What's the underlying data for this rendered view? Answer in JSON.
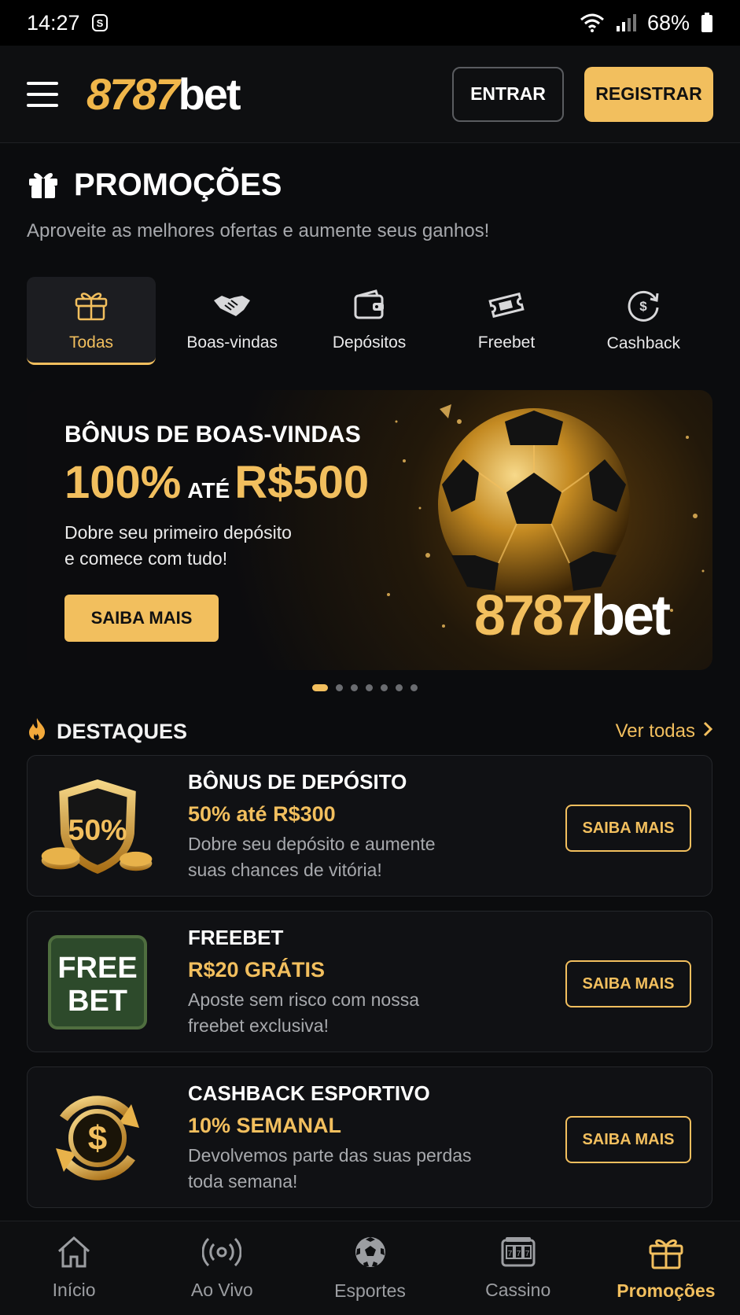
{
  "status_bar": {
    "time": "14:27",
    "battery": "68%"
  },
  "header": {
    "logo_number": "8787",
    "logo_text": "bet",
    "login_label": "ENTRAR",
    "register_label": "REGISTRAR"
  },
  "page": {
    "title": "PROMOÇÕES",
    "subtitle": "Aproveite as melhores ofertas e aumente seus ganhos!"
  },
  "tabs": [
    {
      "label": "Todas",
      "icon": "gift-icon",
      "active": true
    },
    {
      "label": "Boas-vindas",
      "icon": "handshake-icon"
    },
    {
      "label": "Depósitos",
      "icon": "wallet-icon"
    },
    {
      "label": "Freebet",
      "icon": "ticket-icon"
    },
    {
      "label": "Cashback",
      "icon": "cashback-icon"
    }
  ],
  "hero": {
    "title": "BÔNUS DE BOAS-VINDAS",
    "percent": "100%",
    "ate": "ATÉ",
    "amount": "R$500",
    "desc_line1": "Dobre seu primeiro depósito",
    "desc_line2": "e comece com tudo!",
    "button": "SAIBA MAIS",
    "logo_number": "8787",
    "logo_text": "bet",
    "slides": 7,
    "active_slide": 1
  },
  "destaques": {
    "title": "DESTAQUES",
    "see_all": "Ver todas",
    "items": [
      {
        "badge_text": "50%",
        "title": "BÔNUS DE DEPÓSITO",
        "offer": "50% até R$300",
        "desc_line1": "Dobre seu depósito e aumente",
        "desc_line2": "suas chances de vitória!",
        "button": "SAIBA MAIS"
      },
      {
        "badge_line1": "FREE",
        "badge_line2": "BET",
        "title": "FREEBET",
        "offer": "R$20 GRÁTIS",
        "desc_line1": "Aposte sem risco com nossa",
        "desc_line2": "freebet exclusiva!",
        "button": "SAIBA MAIS"
      },
      {
        "title": "CASHBACK ESPORTIVO",
        "offer": "10% SEMANAL",
        "desc_line1": "Devolvemos parte das suas perdas",
        "desc_line2": "toda semana!",
        "button": "SAIBA MAIS"
      }
    ]
  },
  "bottom_nav": [
    {
      "label": "Início",
      "icon": "home-icon"
    },
    {
      "label": "Ao Vivo",
      "icon": "live-icon"
    },
    {
      "label": "Esportes",
      "icon": "soccer-ball-icon"
    },
    {
      "label": "Cassino",
      "icon": "slot-machine-icon"
    },
    {
      "label": "Promoções",
      "icon": "gift-icon",
      "active": true
    }
  ],
  "colors": {
    "accent": "#f2bf5e",
    "background": "#0b0c0e",
    "card": "#101114"
  }
}
